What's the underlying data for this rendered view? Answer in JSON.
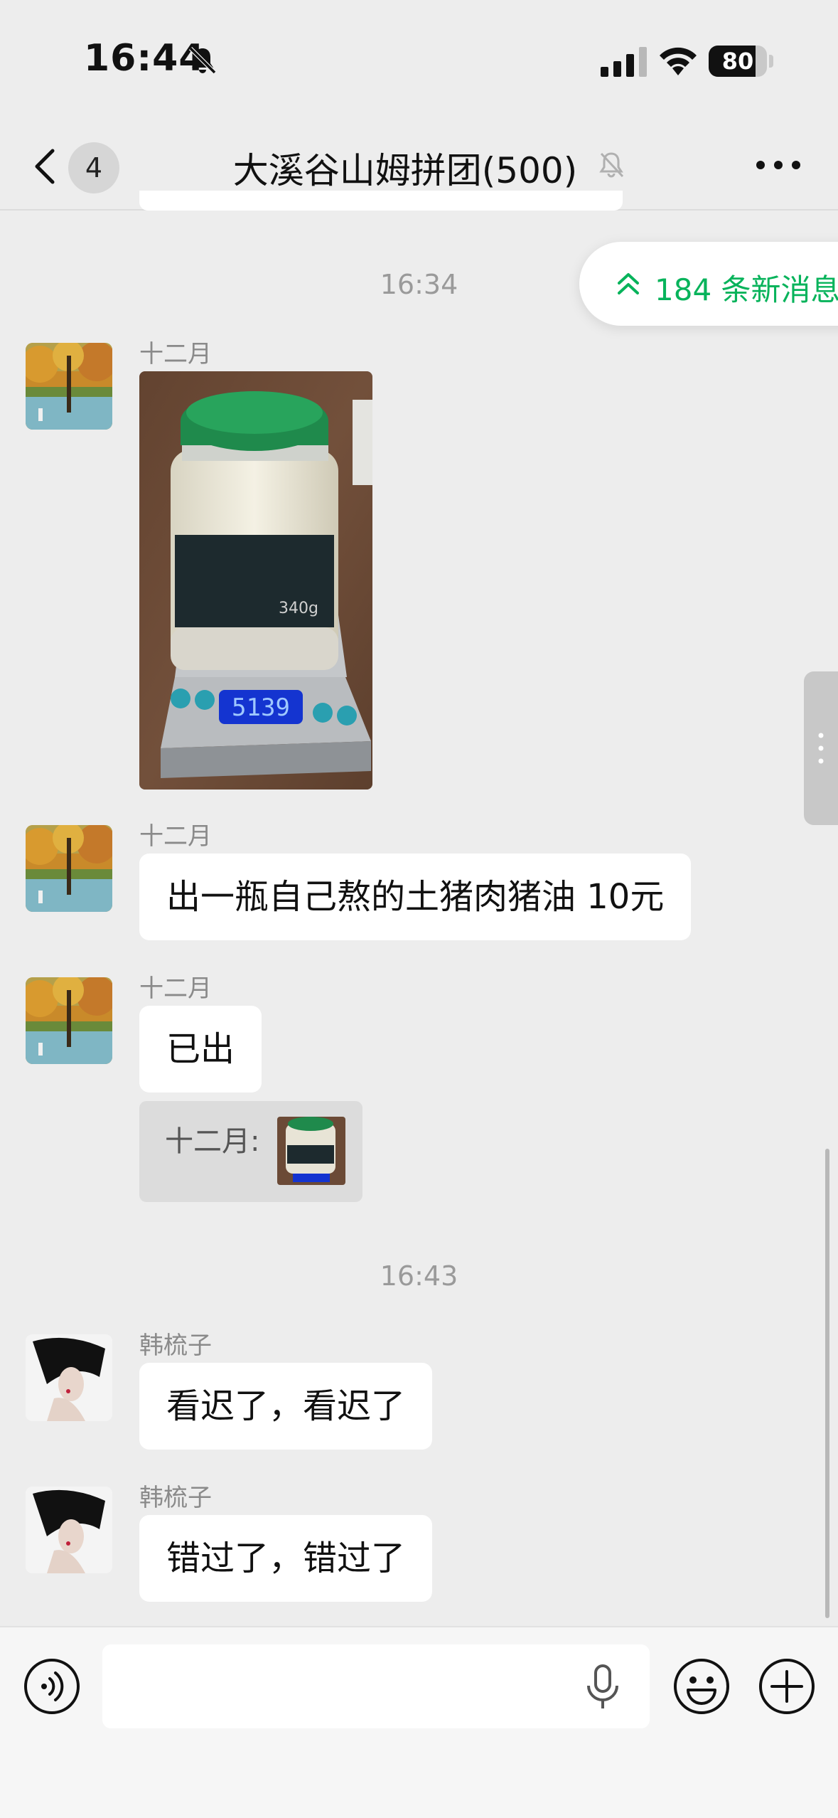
{
  "status_bar": {
    "time": "16:44",
    "battery": "80",
    "battery_level": 0.8,
    "icons": [
      "bell-slash-icon",
      "cellular-signal-icon",
      "wifi-icon",
      "battery-icon"
    ]
  },
  "header": {
    "unread_count": "4",
    "title": "大溪谷山姆拼团(500)",
    "icons": [
      "back-chevron-icon",
      "bell-muted-icon",
      "more-dots-icon"
    ]
  },
  "new_messages_pill": {
    "label": "184 条新消息",
    "color": "#07b35b",
    "icon": "double-chevron-up-icon"
  },
  "messages": {
    "ts1": "16:34",
    "m1": {
      "sender": "十二月",
      "content": "photo-of-lard-jar-on-scale"
    },
    "m2": {
      "sender": "十二月",
      "text": "出一瓶自己熬的土猪肉猪油 10元"
    },
    "m3": {
      "sender": "十二月",
      "text": "已出",
      "quote_label": "十二月:"
    },
    "ts2": "16:43",
    "m4": {
      "sender": "韩梳子",
      "text": "看迟了，看迟了"
    },
    "m5": {
      "sender": "韩梳子",
      "text": "错过了，错过了"
    }
  },
  "photo": {
    "scale_reading": "5139",
    "label_weight": "340g",
    "lid_color": "#1f8a4c"
  },
  "input_bar": {
    "placeholder": "",
    "icons": [
      "voice-icon",
      "microphone-icon",
      "emoji-icon",
      "plus-icon"
    ]
  },
  "colors": {
    "background": "#ededed",
    "bubble": "#ffffff",
    "accent_green": "#07b35b"
  }
}
